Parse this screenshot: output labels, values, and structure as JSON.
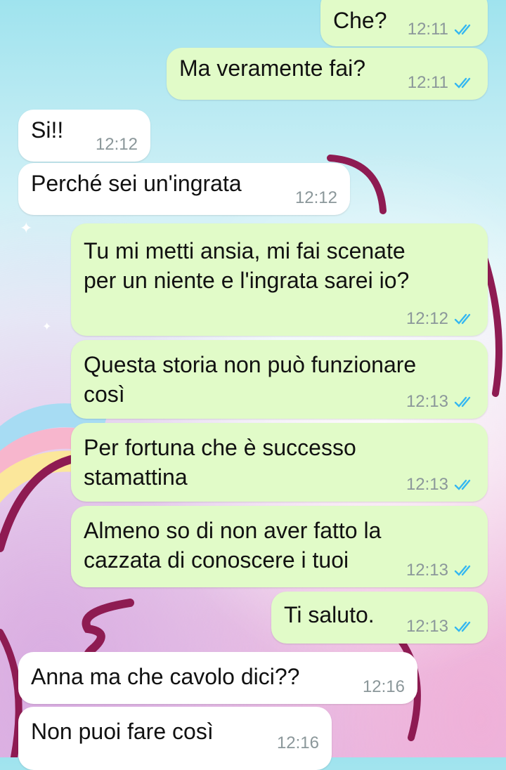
{
  "messages": [
    {
      "text": "Che?",
      "time": "12:11",
      "side": "out"
    },
    {
      "text": "Ma veramente fai?",
      "time": "12:11",
      "side": "out"
    },
    {
      "text": "Si!!",
      "time": "12:12",
      "side": "in"
    },
    {
      "text": "Perché sei un'ingrata",
      "time": "12:12",
      "side": "in"
    },
    {
      "text": "Tu mi metti ansia, mi fai scenate\nper un niente e l'ingrata sarei io?",
      "time": "12:12",
      "side": "out"
    },
    {
      "text": "Questa storia non può funzionare\ncosì",
      "time": "12:13",
      "side": "out"
    },
    {
      "text": "Per fortuna che è successo\nstamattina",
      "time": "12:13",
      "side": "out"
    },
    {
      "text": "Almeno so di non aver fatto la\ncazzata di conoscere i tuoi",
      "time": "12:13",
      "side": "out"
    },
    {
      "text": "Ti saluto.",
      "time": "12:13",
      "side": "out"
    },
    {
      "text": "Anna ma che cavolo dici??",
      "time": "12:16",
      "side": "in"
    },
    {
      "text": "Non puoi fare così",
      "time": "12:16",
      "side": "in"
    }
  ],
  "colors": {
    "outgoing_bubble": "#e1fbc8",
    "incoming_bubble": "#ffffff",
    "read_ticks": "#34b7f1",
    "timestamp": "#8b979a"
  },
  "icons": {
    "read_receipt": "double-check-icon"
  }
}
